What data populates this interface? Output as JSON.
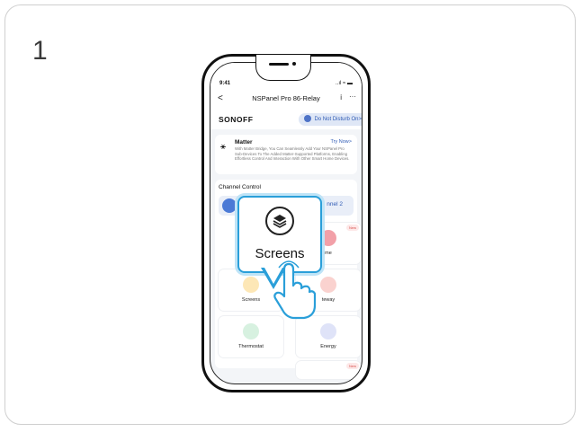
{
  "step_number": "1",
  "status_bar": {
    "time": "9:41",
    "icons": "..ıl ≈ ▬"
  },
  "nav": {
    "back": "<",
    "title": "NSPanel Pro 86-Relay",
    "info": "i",
    "more": "···"
  },
  "brand": {
    "logo": "SONOFF",
    "dnd_label": "Do Not Disturb On>"
  },
  "matter": {
    "title": "Matter",
    "action": "Try Now>",
    "description": "With Matter Bridge, You Can Seamlessly Add Your NSPanel Pro Sub-Devices To The Added Matter-Supported Platforms, Enabling Effortless Control And Interaction With Other Smart Home Devices."
  },
  "channel": {
    "label": "Channel Control",
    "channel2": "nnel 2"
  },
  "tiles": [
    {
      "label": "me",
      "badge": "New",
      "color": "#f2a0a8"
    },
    {
      "label": "Screens",
      "color": "#f5c043"
    },
    {
      "label": "teway",
      "color": "#e9524a"
    },
    {
      "label": "Thermostat",
      "color": "#7dcf9a"
    },
    {
      "label": "Energy",
      "color": "#5b6bd6"
    }
  ],
  "bottom_badge": "New",
  "callout": {
    "label": "Screens",
    "icon": "screens-icon"
  },
  "colors": {
    "accent": "#2a9fd9",
    "link": "#2f5bb5"
  }
}
